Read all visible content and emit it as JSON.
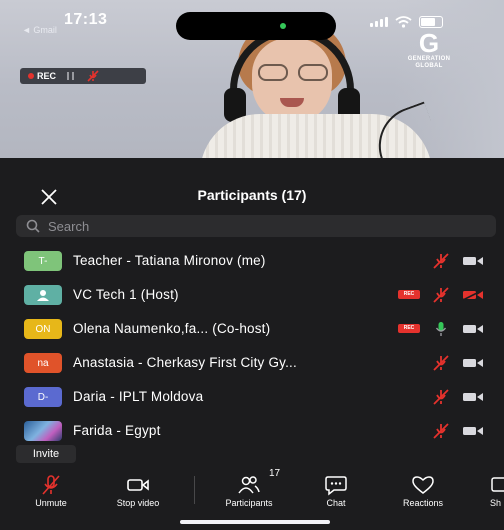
{
  "status_bar": {
    "time": "17:13",
    "back_app": "◄ Gmail"
  },
  "video": {
    "rec_label": "REC",
    "logo_mark": "G",
    "logo_line1": "GENERATION",
    "logo_line2": "GLOBAL"
  },
  "panel": {
    "title": "Participants (17)",
    "search_placeholder": "Search",
    "invite_label": "Invite"
  },
  "participants": [
    {
      "avatar": "T-",
      "avatar_color": "#7fc47a",
      "name": "Teacher - Tatiana Mironov (me)",
      "recording": false,
      "mic": "muted",
      "video": "on"
    },
    {
      "avatar": "",
      "avatar_color": "#5fb0a4",
      "name": "VC Tech 1 (Host)",
      "recording": true,
      "mic": "muted",
      "video": "off"
    },
    {
      "avatar": "ON",
      "avatar_color": "#e7b719",
      "name": "Olena Naumenko,fa...  (Co-host)",
      "recording": true,
      "mic": "active",
      "video": "on"
    },
    {
      "avatar": "na",
      "avatar_color": "#e0532a",
      "name": "Anastasia - Cherkasy First City Gy...",
      "recording": false,
      "mic": "muted",
      "video": "on"
    },
    {
      "avatar": "D-",
      "avatar_color": "#5b6ad0",
      "name": "Daria - IPLT Moldova",
      "recording": false,
      "mic": "muted",
      "video": "on"
    },
    {
      "avatar": "",
      "avatar_color": "#3d7fb8",
      "name": "Farida - Egypt",
      "recording": false,
      "mic": "muted",
      "video": "on"
    }
  ],
  "rec_badge_text": "REC",
  "toolbar": {
    "unmute": "Unmute",
    "stop_video": "Stop video",
    "participants": "Participants",
    "participants_count": "17",
    "chat": "Chat",
    "reactions": "Reactions",
    "share": "Sh"
  },
  "colors": {
    "muted_red": "#e5322d",
    "mic_green": "#35c759",
    "panel_bg": "#1c1c1e"
  }
}
